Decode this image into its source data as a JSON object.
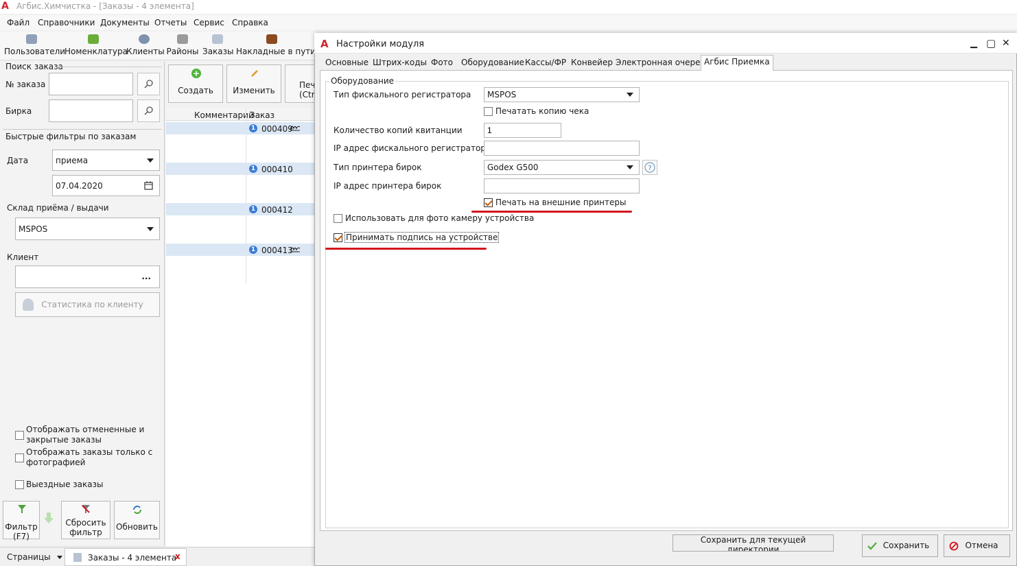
{
  "app": {
    "title": "Агбис.Химчистка - [Заказы - 4 элемента]"
  },
  "menu": [
    "Файл",
    "Справочники",
    "Документы",
    "Отчеты",
    "Сервис",
    "Справка"
  ],
  "toolbar": {
    "users": "Пользователи",
    "nomenclature": "Номенклатура",
    "clients": "Клиенты",
    "districts": "Районы",
    "orders": "Заказы",
    "waybills": "Накладные в пути"
  },
  "search": {
    "group_title": "Поиск заказа",
    "order_no_label": "№ заказа",
    "order_no_value": "",
    "tag_label": "Бирка",
    "tag_value": ""
  },
  "filters": {
    "group_title": "Быстрые фильтры по заказам",
    "date_label": "Дата",
    "date_type": "приема",
    "date_value": "07.04.2020",
    "warehouse_label": "Склад приёма / выдачи",
    "warehouse_value": "MSPOS",
    "client_label": "Клиент",
    "client_value": "",
    "client_more": "...",
    "client_stats": "Статистика по клиенту",
    "show_cancelled": "Отображать отмененные и закрытые заказы",
    "show_with_photo": "Отображать заказы только с фотографией",
    "field_orders": "Выездные заказы",
    "filter_btn_line1": "Фильтр",
    "filter_btn_line2": "(F7)",
    "reset_btn_line1": "Сбросить",
    "reset_btn_line2": "фильтр",
    "refresh_btn": "Обновить"
  },
  "actions": {
    "create": "Создать",
    "edit": "Изменить",
    "print_line1": "Печ",
    "print_line2": "(Ctrl"
  },
  "grid": {
    "columns": [
      "Комментарий",
      "Заказ"
    ],
    "rows": [
      {
        "order": "000409",
        "signed": true
      },
      {
        "order": "000410",
        "signed": false
      },
      {
        "order": "000412",
        "signed": false
      },
      {
        "order": "000413",
        "signed": true
      }
    ]
  },
  "status": {
    "pages": "Страницы",
    "doc_tab": "Заказы - 4 элемента",
    "close": "x"
  },
  "dialog": {
    "title": "Настройки модуля",
    "minimize": "▁",
    "maximize": "▢",
    "close": "✕",
    "tabs": [
      "Основные",
      "Штрих-коды",
      "Фото",
      "Оборудование",
      "Кассы/ФР",
      "Конвейер",
      "Электронная очередь",
      "Агбис Приемка"
    ],
    "active_tab": "Агбис Приемка",
    "group_title": "Оборудование",
    "fiscal_type_label": "Тип фискального регистратора",
    "fiscal_type_value": "MSPOS",
    "print_copy_label": "Печатать копию чека",
    "print_copy_checked": false,
    "copies_label": "Количество копий квитанции",
    "copies_value": "1",
    "fiscal_ip_label": "IP адрес фискального регистратора",
    "fiscal_ip_value": "",
    "tag_printer_type_label": "Тип принтера бирок",
    "tag_printer_type_value": "Godex G500",
    "tag_printer_ip_label": "IP адрес принтера бирок",
    "tag_printer_ip_value": "",
    "external_print_label": "Печать на внешние принтеры",
    "external_print_checked": true,
    "device_camera_label": "Использовать для фото камеру устройства",
    "device_camera_checked": false,
    "accept_signature_label": "Принимать подпись на устройстве",
    "accept_signature_checked": true,
    "save_dir_btn": "Сохранить для текущей директории",
    "save_btn": "Сохранить",
    "cancel_btn": "Отмена"
  },
  "colors": {
    "accent_red": "#d4141c",
    "highlight_row": "#dbe7f4",
    "check_orange": "#c75a00"
  }
}
